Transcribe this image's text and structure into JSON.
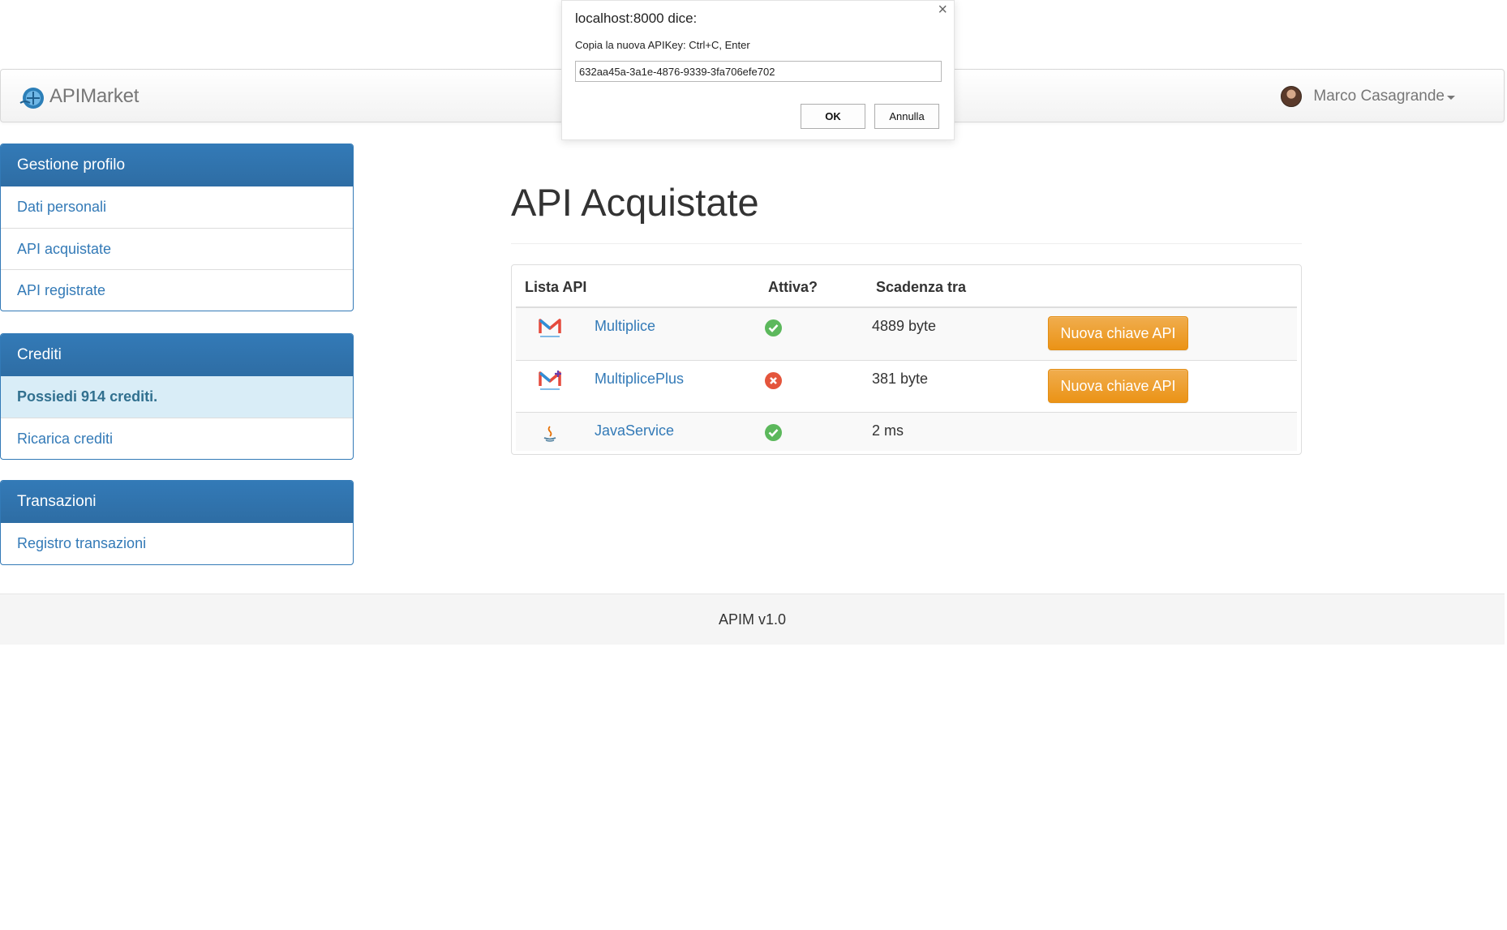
{
  "brand": {
    "name": "APIMarket"
  },
  "user": {
    "name": "Marco Casagrande"
  },
  "sidebar": {
    "profile": {
      "title": "Gestione profilo",
      "items": [
        {
          "label": "Dati personali"
        },
        {
          "label": "API acquistate"
        },
        {
          "label": "API registrate"
        }
      ]
    },
    "credits": {
      "title": "Crediti",
      "balance_text": "Possiedi 914 crediti.",
      "items": [
        {
          "label": "Ricarica crediti"
        }
      ]
    },
    "transactions": {
      "title": "Transazioni",
      "items": [
        {
          "label": "Registro transazioni"
        }
      ]
    }
  },
  "main": {
    "title": "API Acquistate",
    "table": {
      "headers": [
        "Lista API",
        "Attiva?",
        "Scadenza tra",
        ""
      ],
      "rows": [
        {
          "name": "Multiplice",
          "logo": "multiplice-logo",
          "active": true,
          "status_icon": "check-circle-icon",
          "expires": "4889 byte",
          "action_label": "Nuova chiave API"
        },
        {
          "name": "MultiplicePlus",
          "logo": "multiplice-plus-logo",
          "active": false,
          "status_icon": "x-circle-icon",
          "expires": "381 byte",
          "action_label": "Nuova chiave API"
        },
        {
          "name": "JavaService",
          "logo": "java-logo",
          "active": true,
          "status_icon": "check-circle-icon",
          "expires": "2 ms",
          "action_label": ""
        }
      ]
    }
  },
  "footer": {
    "text": "APIM v1.0"
  },
  "dialog": {
    "title": "localhost:8000 dice:",
    "message": "Copia la nuova APIKey: Ctrl+C, Enter",
    "input_value": "632aa45a-3a1e-4876-9339-3fa706efe702",
    "ok_label": "OK",
    "cancel_label": "Annulla",
    "close_glyph": "×"
  },
  "colors": {
    "primary": "#337ab7",
    "warning": "#f0ad4e",
    "success": "#5cb85c",
    "danger": "#e4553c",
    "info_bg": "#d9edf7"
  }
}
